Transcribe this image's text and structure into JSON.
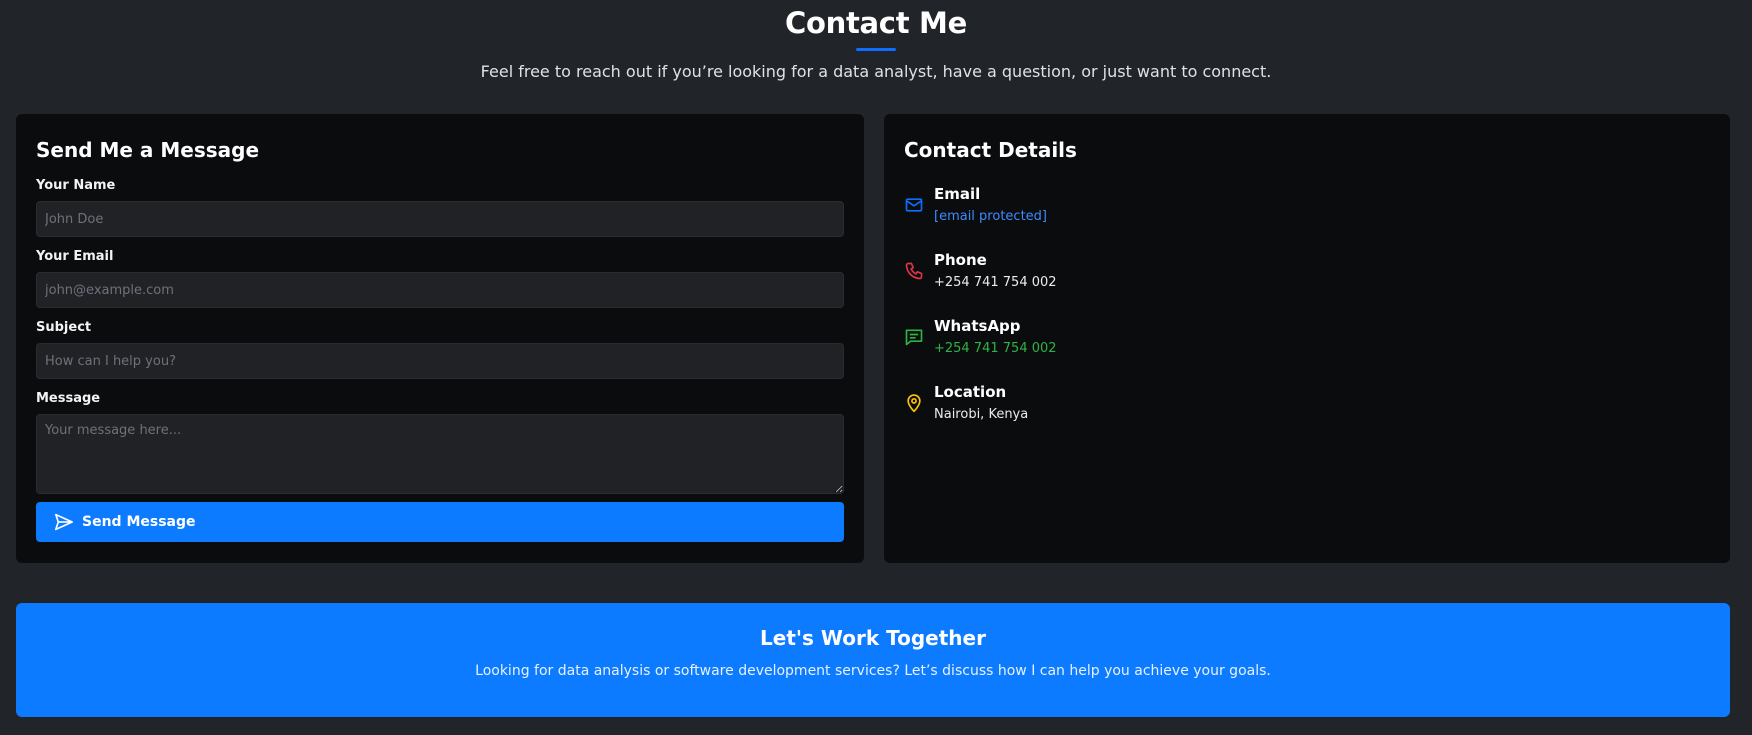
{
  "header": {
    "title": "Contact Me",
    "subtitle": "Feel free to reach out if you’re looking for a data analyst, have a question, or just want to connect."
  },
  "form": {
    "title": "Send Me a Message",
    "name_label": "Your Name",
    "name_placeholder": "John Doe",
    "email_label": "Your Email",
    "email_placeholder": "john@example.com",
    "subject_label": "Subject",
    "subject_placeholder": "How can I help you?",
    "message_label": "Message",
    "message_placeholder": "Your message here...",
    "send_label": "Send Message",
    "send_icon": "send-icon"
  },
  "details": {
    "title": "Contact Details",
    "items": [
      {
        "label": "Email",
        "value": "[email protected]",
        "icon": "mail-icon",
        "color": "#0d6efd"
      },
      {
        "label": "Phone",
        "value": "+254 741 754 002",
        "icon": "phone-icon",
        "color": "#dc3545"
      },
      {
        "label": "WhatsApp",
        "value": "+254 741 754 002",
        "icon": "chat-icon",
        "color": "#2fb344"
      },
      {
        "label": "Location",
        "value": "Nairobi, Kenya",
        "icon": "map-pin-icon",
        "color": "#ffc107"
      }
    ]
  },
  "cta": {
    "title": "Let's Work Together",
    "text": "Looking for data analysis or software development services? Let’s discuss how I can help you achieve your goals."
  },
  "colors": {
    "background": "#212529",
    "card": "#0b0c0e",
    "accent": "#0d7bff"
  }
}
